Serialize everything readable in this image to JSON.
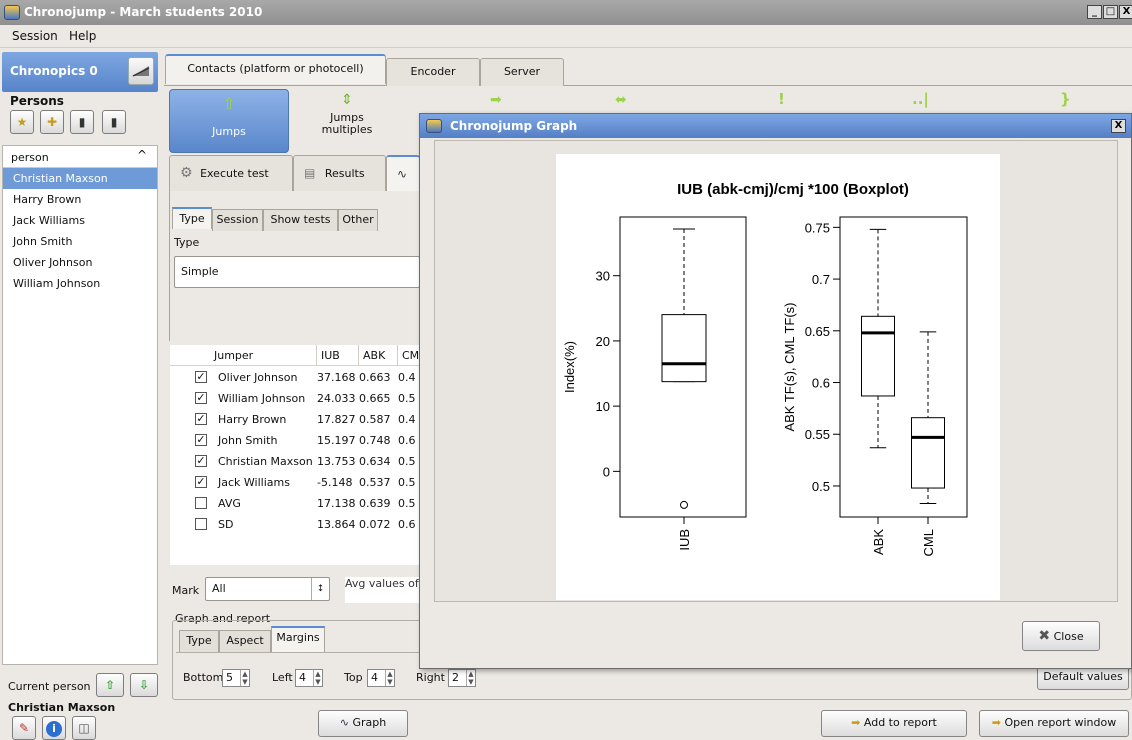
{
  "window": {
    "title": "Chronojump - March students 2010",
    "controls": [
      "_",
      "□",
      "X"
    ]
  },
  "menu": {
    "session": "Session",
    "help": "Help"
  },
  "left": {
    "chronopics": "Chronopics  0",
    "persons_label": "Persons",
    "list_header": "person",
    "persons": [
      "Christian Maxson",
      "Harry Brown",
      "Jack Williams",
      "John Smith",
      "Oliver Johnson",
      "William Johnson"
    ],
    "current_person_label": "Current person",
    "current_person_name": "Christian Maxson"
  },
  "top_tabs": [
    "Contacts (platform or photocell)",
    "Encoder",
    "Server"
  ],
  "test_types": {
    "jumps": "Jumps",
    "jumps_multiples": "Jumps\nmultiples"
  },
  "sub_tabs": {
    "execute": "Execute test",
    "results": "Results"
  },
  "filter_tabs": [
    "Type",
    "Session",
    "Show tests",
    "Other"
  ],
  "type_label": "Type",
  "type_value": "Simple",
  "table": {
    "headers": [
      "Jumper",
      "IUB",
      "ABK",
      "CM"
    ],
    "rows": [
      {
        "checked": true,
        "name": "Oliver Johnson",
        "iub": "37.168",
        "abk": "0.663",
        "cm": "0.4"
      },
      {
        "checked": true,
        "name": "William Johnson",
        "iub": "24.033",
        "abk": "0.665",
        "cm": "0.5"
      },
      {
        "checked": true,
        "name": "Harry Brown",
        "iub": "17.827",
        "abk": "0.587",
        "cm": "0.4"
      },
      {
        "checked": true,
        "name": "John Smith",
        "iub": "15.197",
        "abk": "0.748",
        "cm": "0.6"
      },
      {
        "checked": true,
        "name": "Christian Maxson",
        "iub": "13.753",
        "abk": "0.634",
        "cm": "0.5"
      },
      {
        "checked": true,
        "name": "Jack Williams",
        "iub": "-5.148",
        "abk": "0.537",
        "cm": "0.5"
      },
      {
        "checked": false,
        "name": "AVG",
        "iub": "17.138",
        "abk": "0.639",
        "cm": "0.5"
      },
      {
        "checked": false,
        "name": "SD",
        "iub": "13.864",
        "abk": "0.072",
        "cm": "0.6"
      }
    ]
  },
  "mark": {
    "label": "Mark",
    "value": "All",
    "avg_text": "Avg values of"
  },
  "graph_report": {
    "label": "Graph and report",
    "tabs": [
      "Type",
      "Aspect",
      "Margins"
    ],
    "bottom_label": "Bottom",
    "bottom_value": "5",
    "left_label": "Left",
    "left_value": "4",
    "top_label": "Top",
    "top_value": "4",
    "right_label": "Right",
    "right_value": "2",
    "default_values": "Default values"
  },
  "bottom_buttons": {
    "graph": "Graph",
    "add_report": "Add to report",
    "open_report": "Open report window"
  },
  "dialog": {
    "title": "Chronojump Graph",
    "close_label": "Close"
  },
  "chart_data": {
    "type": "boxplot",
    "title": "IUB (abk-cmj)/cmj *100 (Boxplot)",
    "panels": [
      {
        "ylabel": "Index(%)",
        "yticks": [
          0,
          10,
          20,
          30
        ],
        "ylim": [
          -7,
          39
        ],
        "boxes": [
          {
            "name": "IUB",
            "min": 13.753,
            "q1": 13.753,
            "median": 16.5,
            "q3": 24.033,
            "max": 37.168,
            "outliers": [
              -5.148
            ]
          }
        ]
      },
      {
        "ylabel": "ABK TF(s), CML TF(s)",
        "yticks": [
          0.5,
          0.55,
          0.6,
          0.65,
          0.7,
          0.75
        ],
        "ylim": [
          0.47,
          0.76
        ],
        "boxes": [
          {
            "name": "ABK",
            "min": 0.537,
            "q1": 0.587,
            "median": 0.648,
            "q3": 0.664,
            "max": 0.748,
            "outliers": []
          },
          {
            "name": "CML",
            "min": 0.483,
            "q1": 0.498,
            "median": 0.547,
            "q3": 0.566,
            "max": 0.649,
            "outliers": []
          }
        ]
      }
    ]
  }
}
